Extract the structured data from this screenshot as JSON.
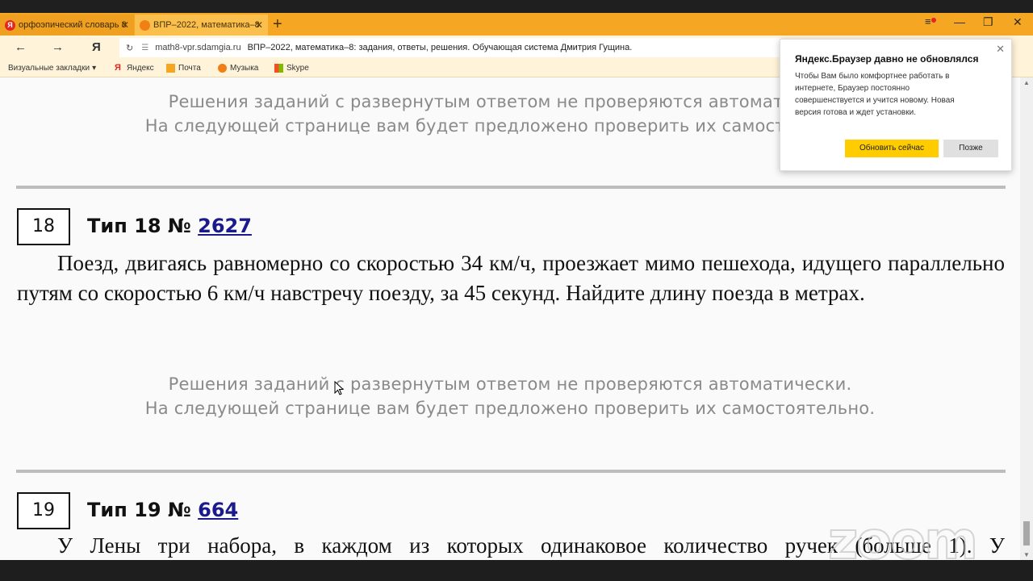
{
  "tabs": [
    {
      "label": "орфоэпический словарь 8"
    },
    {
      "label": "ВПР–2022, математика–8"
    }
  ],
  "address": {
    "url": "math8-vpr.sdamgia.ru",
    "page_title": "ВПР–2022, математика–8: задания, ответы, решения. Обучающая система Дмитрия Гущина."
  },
  "bookmarks": {
    "visual": "Визуальные закладки",
    "yandex": "Яндекс",
    "mail": "Почта",
    "music": "Музыка",
    "skype": "Skype"
  },
  "page": {
    "notice_line1": "Решения заданий с развернутым ответом не проверяются автоматически.",
    "notice_line2": "На следующей странице вам будет предложено проверить их самостоятельно.",
    "task18": {
      "number": "18",
      "type": "Тип 18 №",
      "id": "2627",
      "text": "Поезд, двигаясь равномерно со скоростью 34 км/ч, проезжает мимо пешехода, идущего параллельно путям со скоростью 6 км/ч навстречу поезду, за 45 секунд. Найдите длину поезда в метрах."
    },
    "task19": {
      "number": "19",
      "type": "Тип 19 №",
      "id": "664",
      "text": "У Лены три набора, в каждом из которых одинаковое количество ручек (больше 1). У"
    }
  },
  "popup": {
    "title": "Яндекс.Браузер давно не обновлялся",
    "body": "Чтобы Вам было комфортнее работать в интернете, Браузер постоянно совершенствуется и учится новому. Новая версия готова и ждет установки.",
    "update_button": "Обновить сейчас",
    "later_button": "Позже"
  },
  "watermark": "zoom",
  "colors": {
    "tabbar": "#f5a623",
    "update_button": "#ffcc00",
    "link": "#1a1a8c"
  }
}
